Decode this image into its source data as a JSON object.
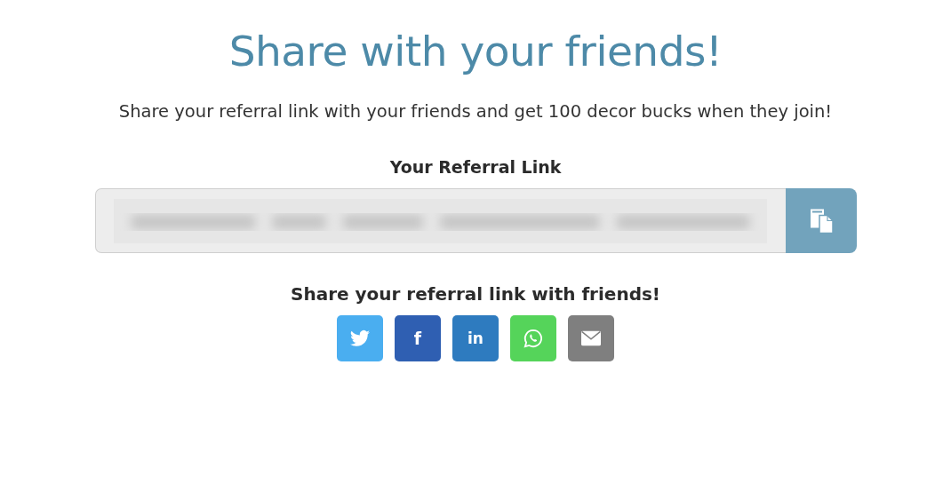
{
  "title": "Share with your friends!",
  "intro": "Share your referral link with your friends and get 100 decor bucks when they join!",
  "referral": {
    "label": "Your Referral Link"
  },
  "share": {
    "heading": "Share your referral link with friends!",
    "buttons": [
      {
        "kind": "twitter",
        "color": "#4aaef0"
      },
      {
        "kind": "facebook",
        "color": "#2f5fb2",
        "glyph": "f"
      },
      {
        "kind": "linkedin",
        "color": "#2e7bbf",
        "glyph": "in"
      },
      {
        "kind": "whatsapp",
        "color": "#55d45a"
      },
      {
        "kind": "email",
        "color": "#7f7f7f"
      }
    ]
  }
}
